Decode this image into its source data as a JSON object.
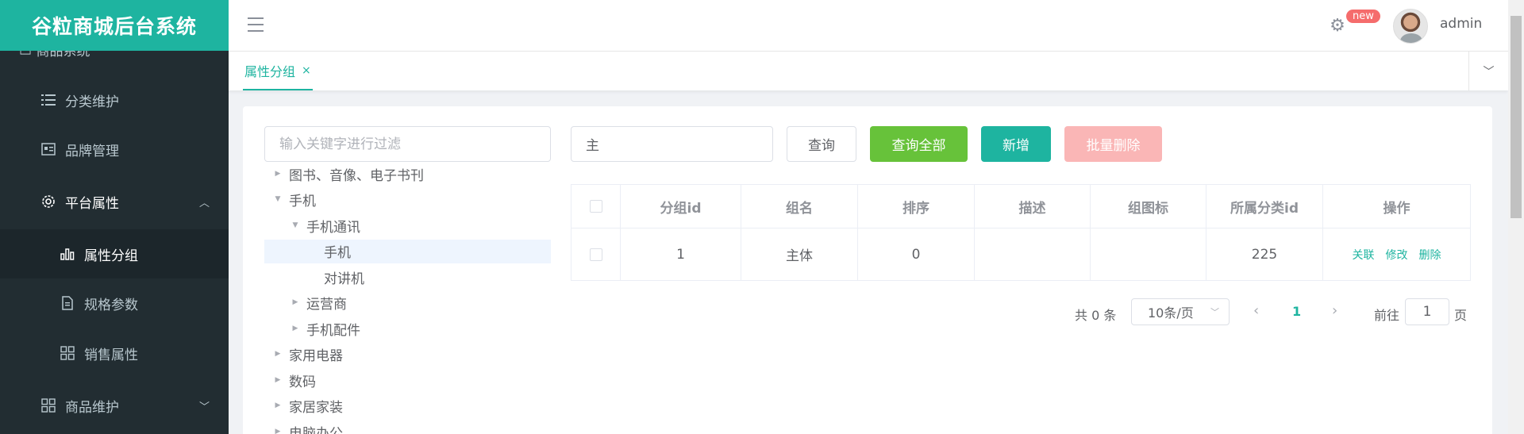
{
  "app_title": "谷粒商城后台系统",
  "sidebar": {
    "partial_label": "商品系统",
    "items": [
      {
        "label": "分类维护",
        "icon": "list-icon"
      },
      {
        "label": "品牌管理",
        "icon": "card-icon"
      },
      {
        "label": "平台属性",
        "icon": "gear-icon",
        "expanded": true
      },
      {
        "label": "属性分组",
        "icon": "bar-chart-icon",
        "active": true
      },
      {
        "label": "规格参数",
        "icon": "document-icon"
      },
      {
        "label": "销售属性",
        "icon": "grid-icon"
      },
      {
        "label": "商品维护",
        "icon": "grid-icon"
      }
    ]
  },
  "header": {
    "badge": "new",
    "username": "admin"
  },
  "tabs": [
    {
      "label": "属性分组",
      "close": "×"
    }
  ],
  "tree": {
    "filter_placeholder": "输入关键字进行过滤",
    "nodes": [
      {
        "label": "图书、音像、电子书刊",
        "caret": "▶"
      },
      {
        "label": "手机",
        "caret": "▼"
      },
      {
        "label": "手机通讯",
        "caret": "▼"
      },
      {
        "label": "手机",
        "caret": ""
      },
      {
        "label": "对讲机",
        "caret": ""
      },
      {
        "label": "运营商",
        "caret": "▶"
      },
      {
        "label": "手机配件",
        "caret": "▶"
      },
      {
        "label": "家用电器",
        "caret": "▶"
      },
      {
        "label": "数码",
        "caret": "▶"
      },
      {
        "label": "家居家装",
        "caret": "▶"
      },
      {
        "label": "电脑办公",
        "caret": "▶"
      }
    ]
  },
  "toolbar": {
    "query_value": "主",
    "query_btn": "查询",
    "query_all_btn": "查询全部",
    "add_btn": "新增",
    "batch_delete_btn": "批量删除"
  },
  "table": {
    "headers": [
      "分组id",
      "组名",
      "排序",
      "描述",
      "组图标",
      "所属分类id",
      "操作"
    ],
    "rows": [
      {
        "id": "1",
        "name": "主体",
        "sort": "0",
        "desc": "",
        "icon": "",
        "catelog_id": "225"
      }
    ],
    "actions": [
      "关联",
      "修改",
      "删除"
    ]
  },
  "pagination": {
    "total": "共 0 条",
    "page_size": "10条/页",
    "current_page": "1",
    "goto_label": "前往",
    "goto_value": "1",
    "page_suffix": "页"
  },
  "colors": {
    "accent": "#1eb4a0",
    "sidebar_bg": "#222d32",
    "success": "#67c23a",
    "danger_light": "#fab6b6",
    "badge": "#f56c6c"
  }
}
